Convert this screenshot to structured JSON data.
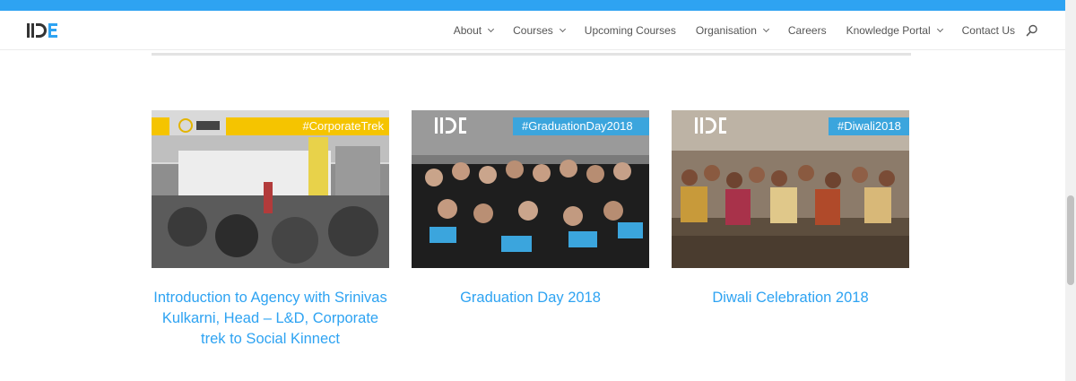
{
  "header": {
    "nav": [
      {
        "label": "About",
        "dropdown": true
      },
      {
        "label": "Courses",
        "dropdown": true
      },
      {
        "label": "Upcoming Courses",
        "dropdown": false
      },
      {
        "label": "Organisation",
        "dropdown": true
      },
      {
        "label": "Careers",
        "dropdown": false
      },
      {
        "label": "Knowledge Portal",
        "dropdown": true
      },
      {
        "label": "Contact Us",
        "dropdown": false
      }
    ]
  },
  "cards": [
    {
      "tag": "#CorporateTrek",
      "title": "Introduction to Agency with Srinivas Kulkarni, Head – L&D, Corporate trek to Social Kinnect"
    },
    {
      "tag": "#GraduationDay2018",
      "title": "Graduation Day 2018"
    },
    {
      "tag": "#Diwali2018",
      "title": "Diwali Celebration 2018"
    }
  ],
  "colors": {
    "accent": "#2ea3f2",
    "tag_yellow": "#f5c400",
    "tag_blue": "#3ba5dd"
  }
}
